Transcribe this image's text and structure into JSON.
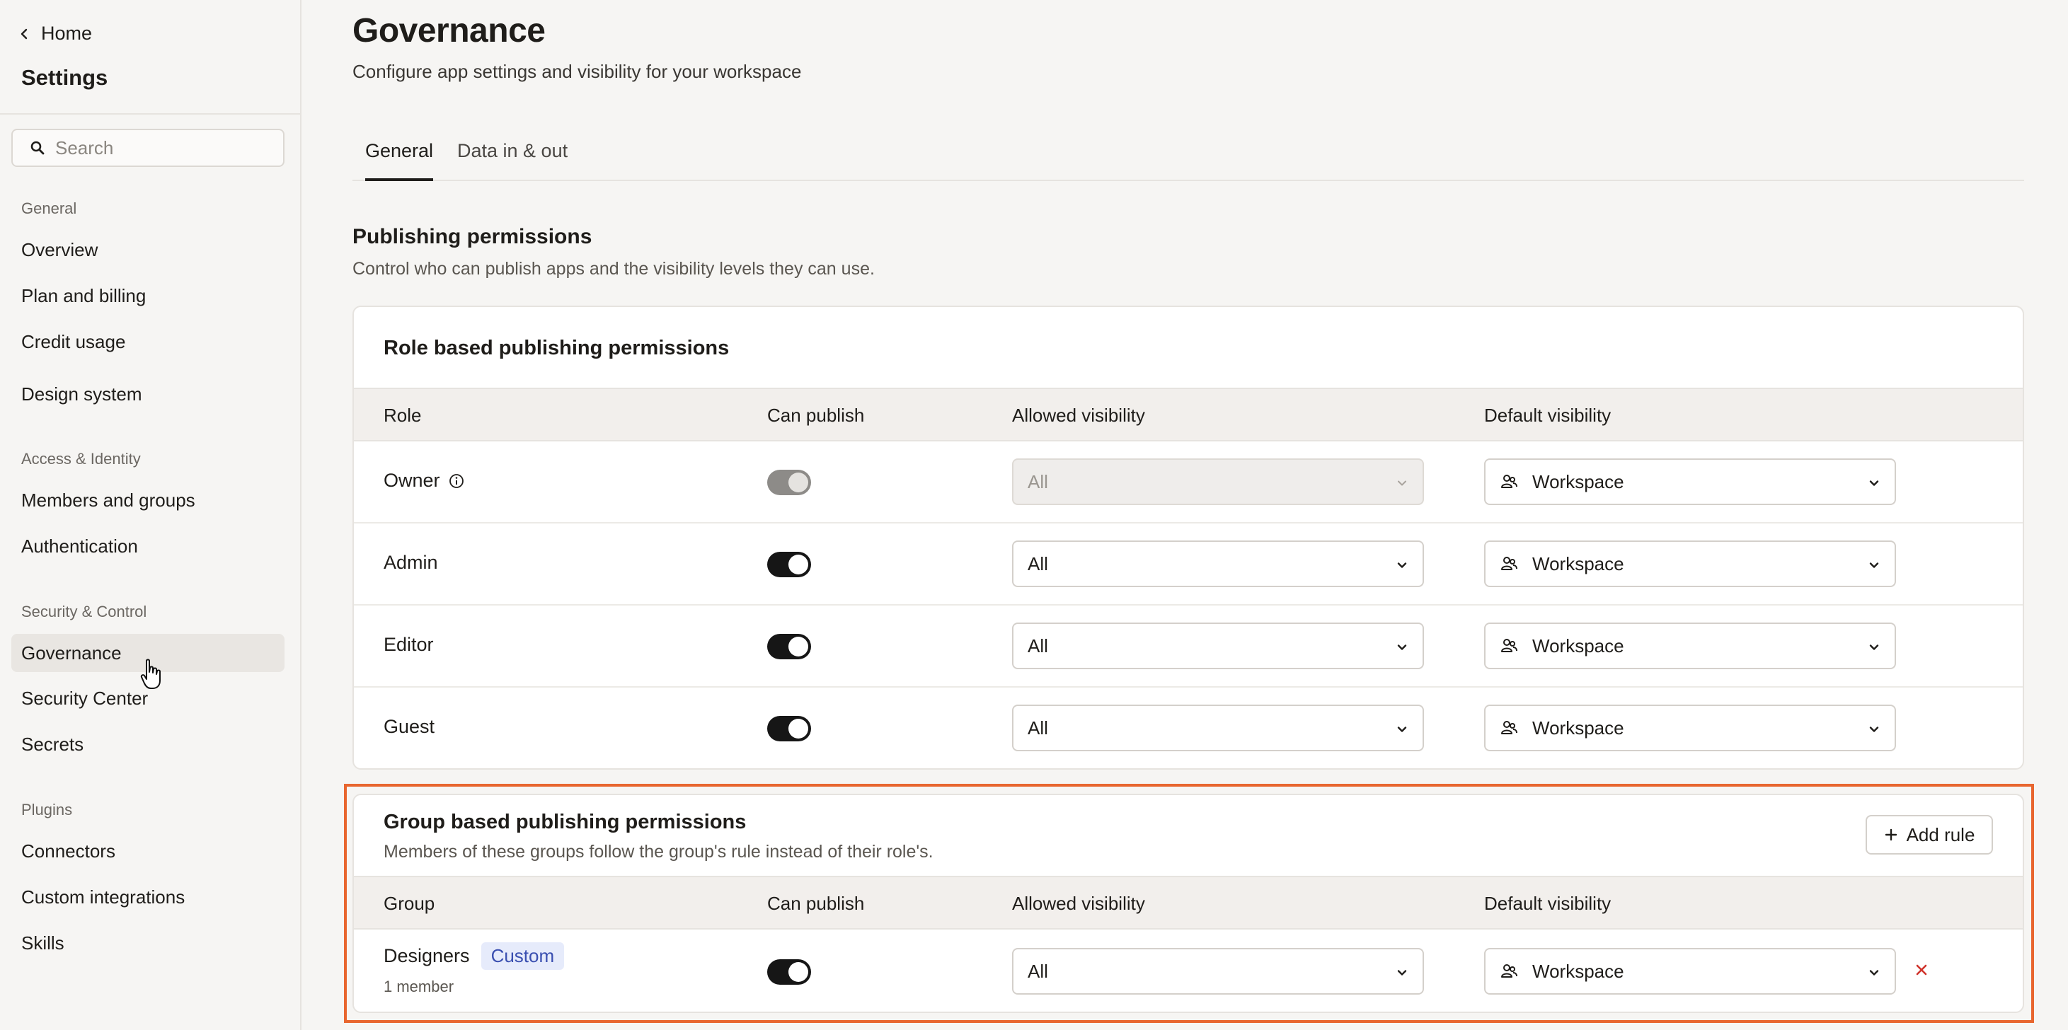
{
  "sidebar": {
    "home_label": "Home",
    "title": "Settings",
    "search_placeholder": "Search",
    "sections": [
      {
        "label": "General",
        "items": [
          "Overview",
          "Plan and billing",
          "Credit usage",
          "Design system"
        ]
      },
      {
        "label": "Access & Identity",
        "items": [
          "Members and groups",
          "Authentication"
        ]
      },
      {
        "label": "Security & Control",
        "items": [
          "Governance",
          "Security Center",
          "Secrets"
        ]
      },
      {
        "label": "Plugins",
        "items": [
          "Connectors",
          "Custom integrations",
          "Skills"
        ]
      }
    ],
    "active_item": "Governance"
  },
  "header": {
    "title": "Governance",
    "subtitle": "Configure app settings and visibility for your workspace"
  },
  "tabs": [
    {
      "label": "General",
      "active": true
    },
    {
      "label": "Data in & out",
      "active": false
    }
  ],
  "publishing": {
    "title": "Publishing permissions",
    "subtitle": "Control who can publish apps and the visibility levels they can use."
  },
  "role_card": {
    "title": "Role based publishing permissions",
    "columns": [
      "Role",
      "Can publish",
      "Allowed visibility",
      "Default visibility"
    ],
    "rows": [
      {
        "role": "Owner",
        "info_icon": "info-icon",
        "can_publish": true,
        "toggle_disabled": true,
        "allowed": "All",
        "allowed_disabled": true,
        "default": "Workspace"
      },
      {
        "role": "Admin",
        "can_publish": true,
        "toggle_disabled": false,
        "allowed": "All",
        "allowed_disabled": false,
        "default": "Workspace"
      },
      {
        "role": "Editor",
        "can_publish": true,
        "toggle_disabled": false,
        "allowed": "All",
        "allowed_disabled": false,
        "default": "Workspace"
      },
      {
        "role": "Guest",
        "can_publish": true,
        "toggle_disabled": false,
        "allowed": "All",
        "allowed_disabled": false,
        "default": "Workspace"
      }
    ]
  },
  "group_card": {
    "title": "Group based publishing permissions",
    "subtitle": "Members of these groups follow the group's rule instead of their role's.",
    "add_rule_label": "Add rule",
    "columns": [
      "Group",
      "Can publish",
      "Allowed visibility",
      "Default visibility"
    ],
    "rows": [
      {
        "group": "Designers",
        "badge": "Custom",
        "members": "1 member",
        "can_publish": true,
        "allowed": "All",
        "default": "Workspace"
      }
    ]
  },
  "colors": {
    "highlight": "#e8662f",
    "toggle_on": "#161616",
    "badge_bg": "#e6ebfb",
    "badge_text": "#3a4fb0",
    "remove": "#d0342c"
  }
}
